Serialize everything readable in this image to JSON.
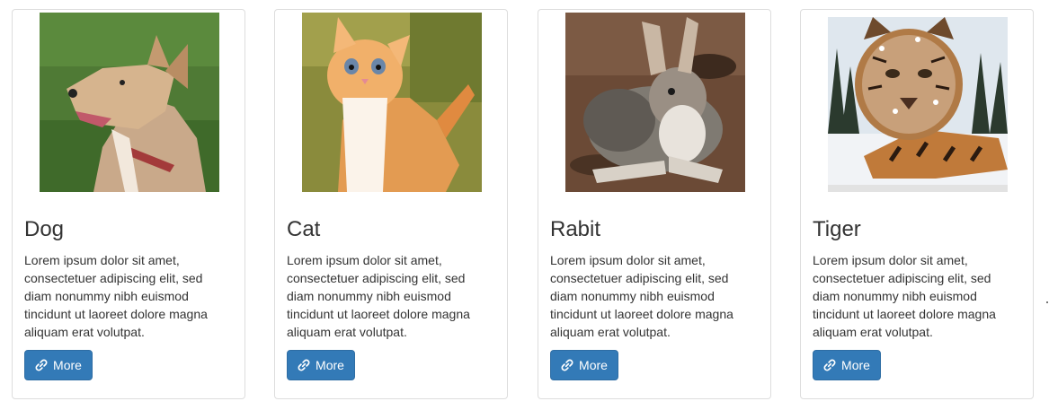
{
  "cards": [
    {
      "title": "Dog",
      "description": "Lorem ipsum dolor sit amet, consectetuer adipiscing elit, sed diam nonummy nibh euismod tincidunt ut laoreet dolore magna aliquam erat volutpat.",
      "button_label": "More",
      "button_icon": "link-icon",
      "image": "dog-photo"
    },
    {
      "title": "Cat",
      "description": "Lorem ipsum dolor sit amet, consectetuer adipiscing elit, sed diam nonummy nibh euismod tincidunt ut laoreet dolore magna aliquam erat volutpat.",
      "button_label": "More",
      "button_icon": "link-icon",
      "image": "cat-photo"
    },
    {
      "title": "Rabit",
      "description": "Lorem ipsum dolor sit amet, consectetuer adipiscing elit, sed diam nonummy nibh euismod tincidunt ut laoreet dolore magna aliquam erat volutpat.",
      "button_label": "More",
      "button_icon": "link-icon",
      "image": "rabbit-photo"
    },
    {
      "title": "Tiger",
      "description": "Lorem ipsum dolor sit amet, consectetuer adipiscing elit, sed diam nonummy nibh euismod tincidunt ut laoreet dolore magna aliquam erat volutpat.",
      "button_label": "More",
      "button_icon": "link-icon",
      "image": "tiger-photo"
    }
  ],
  "colors": {
    "button_bg": "#337ab7",
    "button_border": "#2e6da4",
    "card_border": "#dddddd",
    "text": "#333333"
  }
}
